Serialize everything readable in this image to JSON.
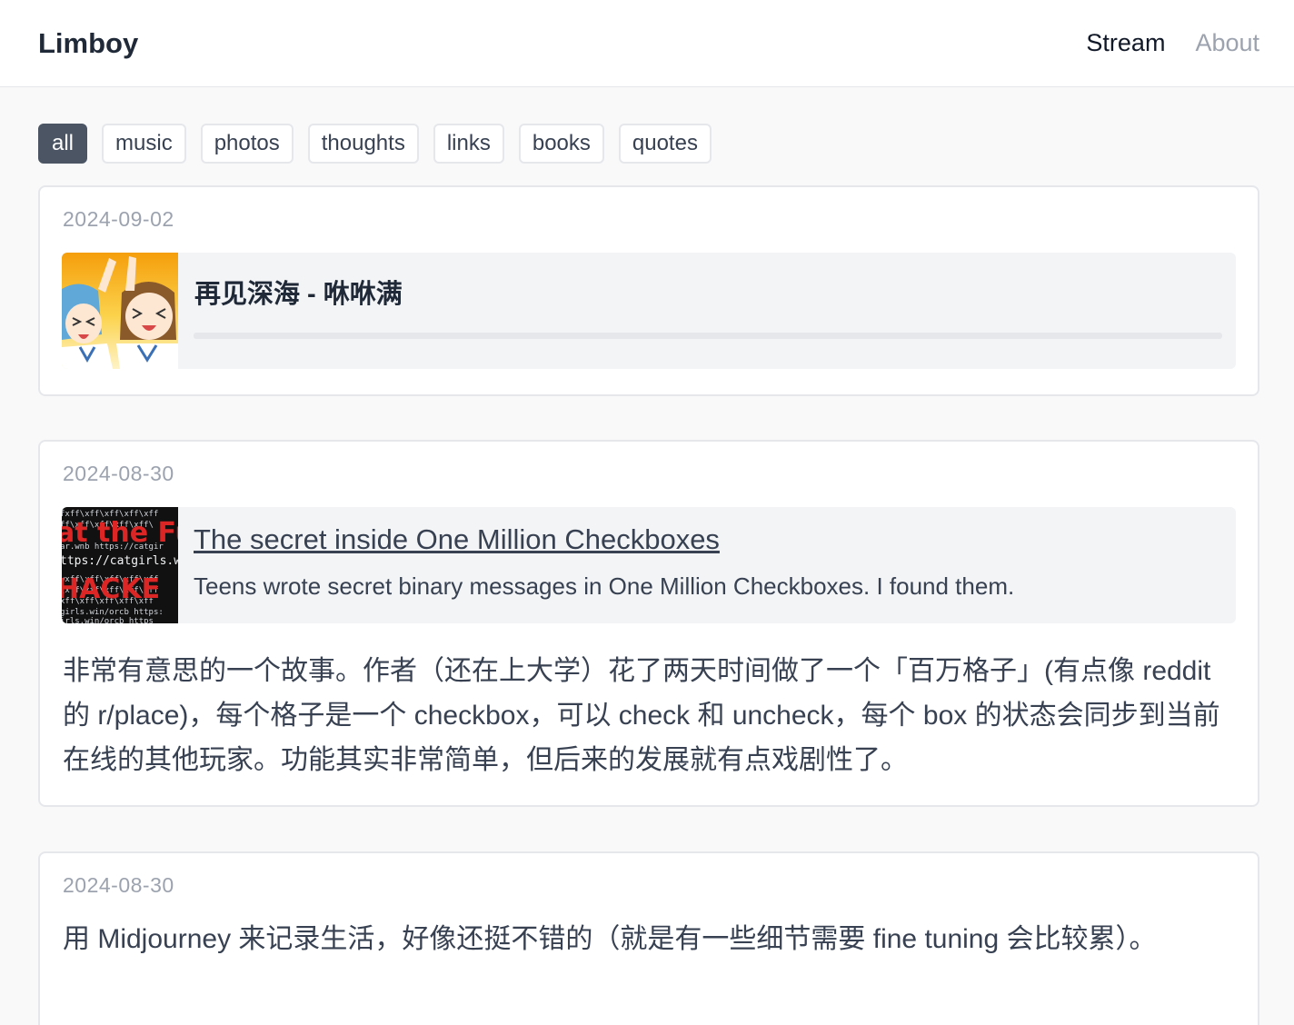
{
  "header": {
    "site_title": "Limboy",
    "nav": [
      {
        "label": "Stream",
        "active": true
      },
      {
        "label": "About",
        "active": false
      }
    ]
  },
  "filters": {
    "selected": "all",
    "tags": [
      "all",
      "music",
      "photos",
      "thoughts",
      "links",
      "books",
      "quotes"
    ]
  },
  "posts": [
    {
      "date": "2024-09-02",
      "type": "music",
      "music": {
        "title": "再见深海 - 咻咻满",
        "progress": 0,
        "thumb_icon": "album-cover-anime"
      }
    },
    {
      "date": "2024-08-30",
      "type": "link",
      "link": {
        "title": "The secret inside One Million Checkboxes",
        "description": "Teens wrote secret binary messages in One Million Checkboxes. I found them.",
        "thumb_icon": "hacker-terminal-thumbnail"
      },
      "body": "非常有意思的一个故事。作者（还在上大学）花了两天时间做了一个「百万格子」(有点像 reddit 的 r/place)，每个格子是一个 checkbox，可以 check 和 uncheck，每个 box 的状态会同步到当前在线的其他玩家。功能其实非常简单，但后来的发展就有点戏剧性了。"
    },
    {
      "date": "2024-08-30",
      "type": "thought",
      "body": "用 Midjourney 来记录生活，好像还挺不错的（就是有一些细节需要 fine tuning 会比较累）。"
    }
  ],
  "colors": {
    "background": "#f9f9f9",
    "card": "#ffffff",
    "border": "#e5e7eb",
    "active_tag": "#4b5563",
    "muted_text": "#9ca3af"
  }
}
